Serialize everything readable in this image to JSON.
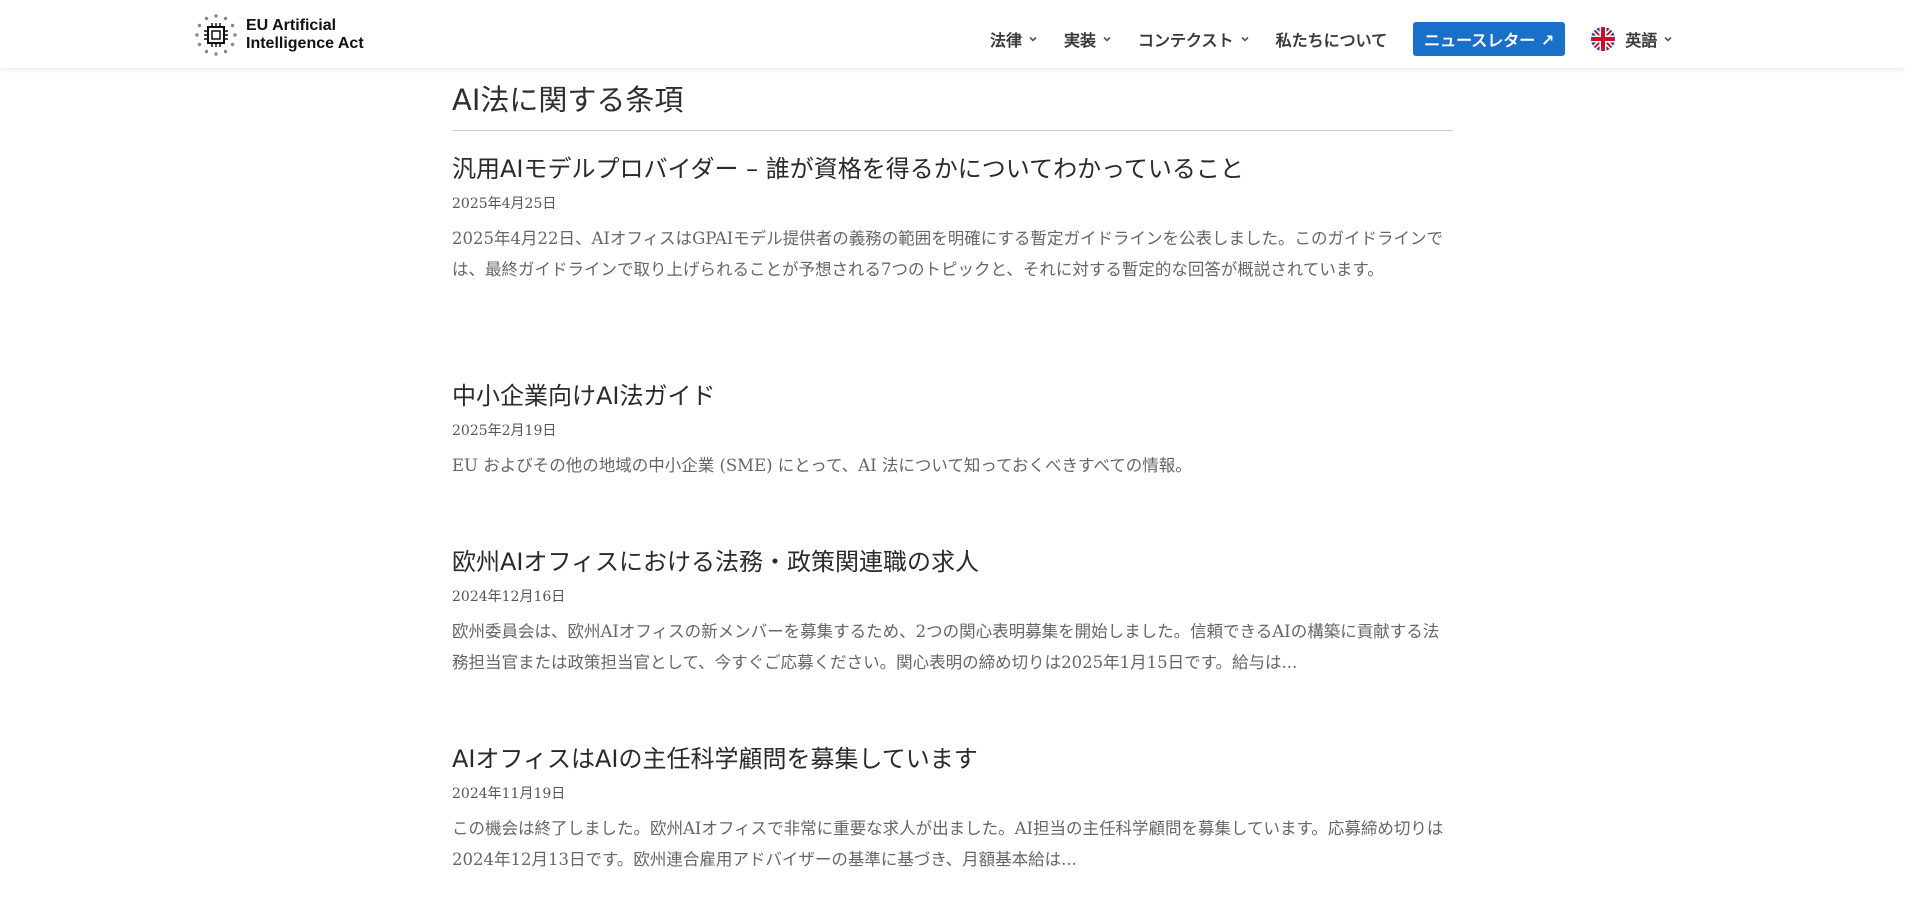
{
  "header": {
    "logo_line1": "EU Artificial",
    "logo_line2": "Intelligence Act",
    "nav": [
      {
        "label": "法律"
      },
      {
        "label": "実装"
      },
      {
        "label": "コンテクスト"
      },
      {
        "label": "私たちについて"
      }
    ],
    "newsletter_label": "ニュースレター ↗",
    "language_label": "英語"
  },
  "colors": {
    "accent": "#1a6fc9",
    "text": "#2a2a2a",
    "muted": "#666666"
  },
  "page": {
    "title": "AI法に関する条項"
  },
  "articles": [
    {
      "title": "汎用AIモデルプロバイダー – 誰が資格を得るかについてわかっていること",
      "date": "2025年4月25日",
      "excerpt": "2025年4月22日、AIオフィスはGPAIモデル提供者の義務の範囲を明確にする暫定ガイドラインを公表しました。このガイドラインでは、最終ガイドラインで取り上げられることが予想される7つのトピックと、それに対する暫定的な回答が概説されています。"
    },
    {
      "title": "中小企業向けAI法ガイド",
      "date": "2025年2月19日",
      "excerpt": "EU およびその他の地域の中小企業 (SME) にとって、AI 法について知っておくべきすべての情報。"
    },
    {
      "title": "欧州AIオフィスにおける法務・政策関連職の求人",
      "date": "2024年12月16日",
      "excerpt": "欧州委員会は、欧州AIオフィスの新メンバーを募集するため、2つの関心表明募集を開始しました。信頼できるAIの構築に貢献する法務担当官または政策担当官として、今すぐご応募ください。関心表明の締め切りは2025年1月15日です。給与は..."
    },
    {
      "title": "AIオフィスはAIの主任科学顧問を募集しています",
      "date": "2024年11月19日",
      "excerpt": "この機会は終了しました。欧州AIオフィスで非常に重要な求人が出ました。AI担当の主任科学顧問を募集しています。応募締め切りは2024年12月13日です。欧州連合雇用アドバイザーの基準に基づき、月額基本給は..."
    }
  ]
}
